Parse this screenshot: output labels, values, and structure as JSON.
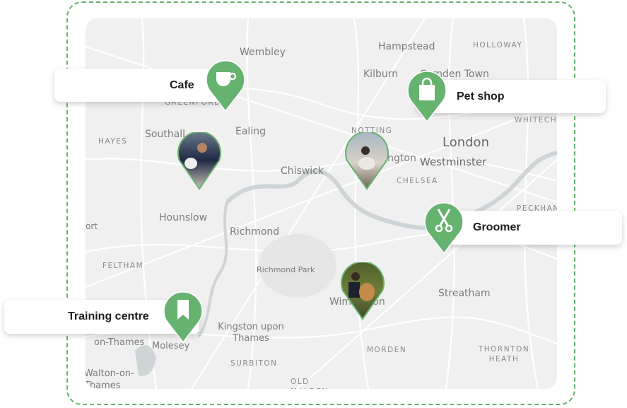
{
  "accent_color": "#66b26f",
  "map_labels": {
    "wembley": "Wembley",
    "hampstead": "Hampstead",
    "holloway": "HOLLOWAY",
    "kilburn": "Kilburn",
    "camden_town": "Camden Town",
    "greenford": "GREENFORD",
    "whitechapel": "WHITECHAPEL",
    "hayes": "HAYES",
    "southall": "Southall",
    "ealing": "Ealing",
    "notting": "NOTTING",
    "kensington": "Kensington",
    "london": "London",
    "westminster": "Westminster",
    "chiswick": "Chiswick",
    "chelsea": "CHELSEA",
    "peckham": "PECKHAM",
    "hounslow": "Hounslow",
    "port": "ort",
    "richmond": "Richmond",
    "feltham": "FELTHAM",
    "richmond_park": "Richmond Park",
    "wimbledon": "Wimbledon",
    "streatham": "Streatham",
    "kingston": "Kingston upon Thames",
    "sunbury": "on-Thames",
    "molesey": "Molesey",
    "morden": "MORDEN",
    "thornton_heath": "THORNTON HEATH",
    "surbiton": "SURBITON",
    "walton": "Walton-on-Thames",
    "old_malden": "OLD MALDEN"
  },
  "places": [
    {
      "label": "Cafe",
      "icon": "coffee-cup-icon"
    },
    {
      "label": "Pet shop",
      "icon": "shopping-bag-icon"
    },
    {
      "label": "Groomer",
      "icon": "scissors-icon"
    },
    {
      "label": "Training centre",
      "icon": "bookmark-icon"
    }
  ],
  "user_pins": [
    {
      "icon": "user-photo-man-with-white-dog"
    },
    {
      "icon": "user-photo-woman-with-dog"
    },
    {
      "icon": "user-photo-man-with-spaniel"
    }
  ]
}
